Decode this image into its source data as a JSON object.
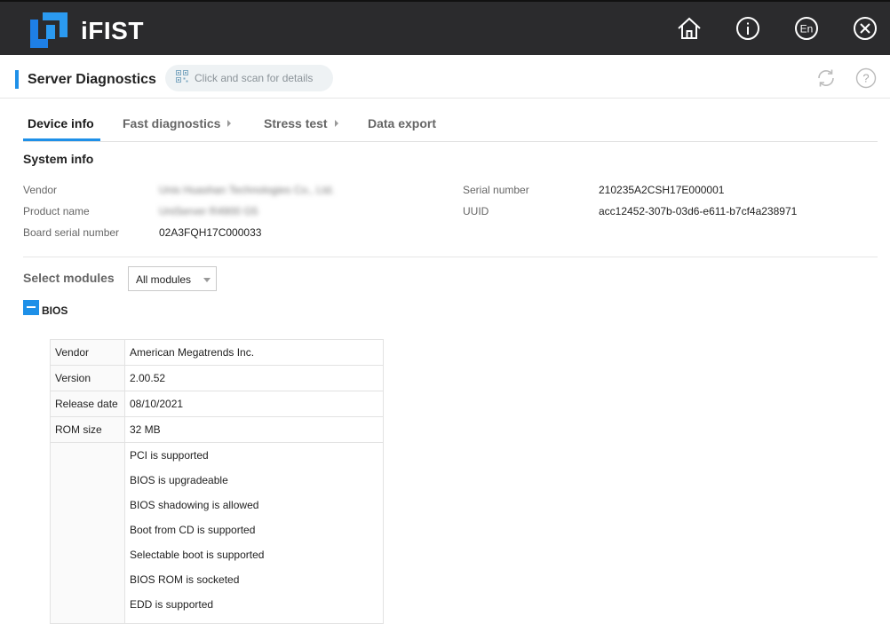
{
  "app": {
    "title": "iFIST"
  },
  "topbar": {
    "icons": [
      {
        "name": "home-icon"
      },
      {
        "name": "info-icon",
        "glyph": "i"
      },
      {
        "name": "language-icon",
        "glyph": "En"
      },
      {
        "name": "close-icon"
      }
    ]
  },
  "header": {
    "title": "Server Diagnostics",
    "scan_hint": "Click and scan for details",
    "accent_color": "#1e90e8"
  },
  "tabs": [
    {
      "label": "Device info",
      "active": true
    },
    {
      "label": "Fast diagnostics",
      "has_submenu": true
    },
    {
      "label": "Stress test",
      "has_submenu": true
    },
    {
      "label": "Data export"
    }
  ],
  "system_info": {
    "title": "System info",
    "vendor_label": "Vendor",
    "vendor_value": "Unis Huashan Technologies Co., Ltd.",
    "product_label": "Product name",
    "product_value": "UniServer R4900 G5",
    "board_serial_label": "Board serial number",
    "board_serial_value": "02A3FQH17C000033",
    "serial_label": "Serial number",
    "serial_value": "210235A2CSH17E000001",
    "uuid_label": "UUID",
    "uuid_value": "acc12452-307b-03d6-e611-b7cf4a238971"
  },
  "modules": {
    "label": "Select modules",
    "selected": "All modules"
  },
  "bios": {
    "title": "BIOS",
    "rows": [
      {
        "key": "Vendor",
        "value": "American Megatrends Inc."
      },
      {
        "key": "Version",
        "value": "2.00.52"
      },
      {
        "key": "Release date",
        "value": "08/10/2021"
      },
      {
        "key": "ROM size",
        "value": "32 MB"
      }
    ],
    "features": [
      "PCI is supported",
      "BIOS is upgradeable",
      "BIOS shadowing is allowed",
      "Boot from CD is supported",
      "Selectable boot is supported",
      "BIOS ROM is socketed",
      "EDD is supported"
    ]
  }
}
